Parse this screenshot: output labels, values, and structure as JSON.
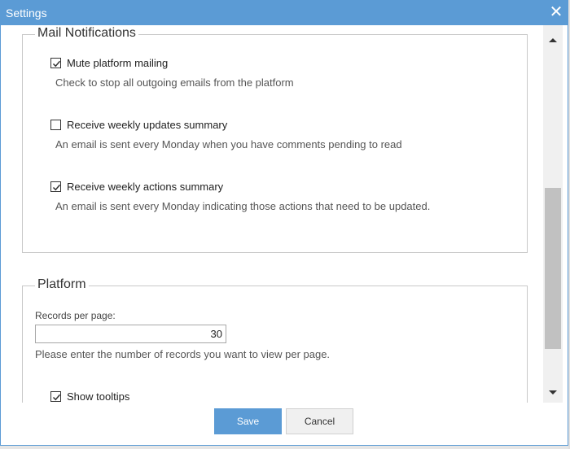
{
  "window": {
    "title": "Settings",
    "close_symbol": "✕"
  },
  "mail": {
    "legend": "Mail Notifications",
    "items": [
      {
        "label": "Mute platform mailing",
        "checked": true,
        "description": "Check to stop all outgoing emails from the platform"
      },
      {
        "label": "Receive weekly updates summary",
        "checked": false,
        "description": "An email is sent every Monday when you have comments pending to read"
      },
      {
        "label": "Receive weekly actions summary",
        "checked": true,
        "description": "An email is sent every Monday indicating those actions that need to be updated."
      }
    ]
  },
  "platform": {
    "legend": "Platform",
    "records_label": "Records per page:",
    "records_value": "30",
    "records_help": "Please enter the number of records you want to view per page.",
    "tooltips_label": "Show tooltips",
    "tooltips_checked": true
  },
  "buttons": {
    "save": "Save",
    "cancel": "Cancel"
  },
  "colors": {
    "accent": "#5b9bd5",
    "border": "#c8c8c8",
    "scrollbar_thumb": "#c1c1c1"
  },
  "icons": {
    "close": "close-icon",
    "check": "check-icon",
    "scroll_up": "arrow-up-icon",
    "scroll_down": "arrow-down-icon"
  }
}
